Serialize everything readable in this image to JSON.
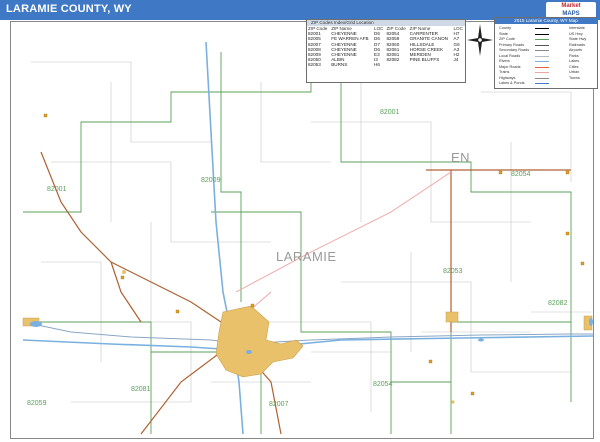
{
  "header": {
    "title": "LARAMIE COUNTY, WY",
    "logo_line1": "Market",
    "logo_line2": "MAPS"
  },
  "map": {
    "county_label": "LARAMIE",
    "partial_label": "EN",
    "zip_labels": [
      "82001",
      "82009",
      "82001",
      "82054",
      "82053",
      "82082",
      "82054",
      "82081",
      "82059",
      "82007"
    ]
  },
  "zip_index": {
    "title": "ZIP Codes Index/Grid Location",
    "headers": [
      "ZIP Code",
      "ZIP Name",
      "LOC",
      "ZIP Code",
      "ZIP Name",
      "LOC"
    ],
    "rows": [
      [
        "82001",
        "CHEYENNE",
        "D6",
        "82054",
        "CARPENTER",
        "H7"
      ],
      [
        "82005",
        "FE WARREN AFB",
        "D6",
        "82059",
        "GRANITE CANON",
        "A7"
      ],
      [
        "82007",
        "CHEYENNE",
        "D7",
        "82060",
        "HILLSDALE",
        "G6"
      ],
      [
        "82008",
        "CHEYENNE",
        "D6",
        "82061",
        "HORSE CREEK",
        "A3"
      ],
      [
        "82009",
        "CHEYENNE",
        "E3",
        "82081",
        "MERIDEN",
        "H2"
      ],
      [
        "82050",
        "ALBIN",
        "I3",
        "82082",
        "PINE BLUFFS",
        "J4"
      ],
      [
        "82053",
        "BURNS",
        "H6",
        "",
        "",
        ""
      ]
    ]
  },
  "legend": {
    "title": "2015 Laramie County, WY Map",
    "rows": [
      [
        "County",
        "Interstate",
        "#000000"
      ],
      [
        "State",
        "US Hwy",
        "#000000"
      ],
      [
        "ZIP Code",
        "State Hwy",
        "#5aa05a"
      ],
      [
        "Primary Roads",
        "Railroads",
        "#555555"
      ],
      [
        "Secondary Roads",
        "Airports",
        "#888888"
      ],
      [
        "Local Roads",
        "Parks",
        "#bbbbbb"
      ],
      [
        "Rivers",
        "Lakes",
        "#7ab0e0"
      ],
      [
        "Major Roads",
        "Cities",
        "#e06040"
      ],
      [
        "Trains",
        "Urban",
        "#f0a8a0"
      ],
      [
        "Highways",
        "Towns",
        "#888888"
      ],
      [
        "Lakes & Ponds",
        "",
        "#3f78c4"
      ]
    ]
  },
  "colors": {
    "title_bar": "#3f78c4",
    "zip_boundary": "#5aa05a",
    "highway": "#b06030",
    "interstate": "#7ab0e0",
    "urban": "#e8c16a",
    "railroad": "#f0a0a0",
    "road": "#aaaaaa"
  }
}
